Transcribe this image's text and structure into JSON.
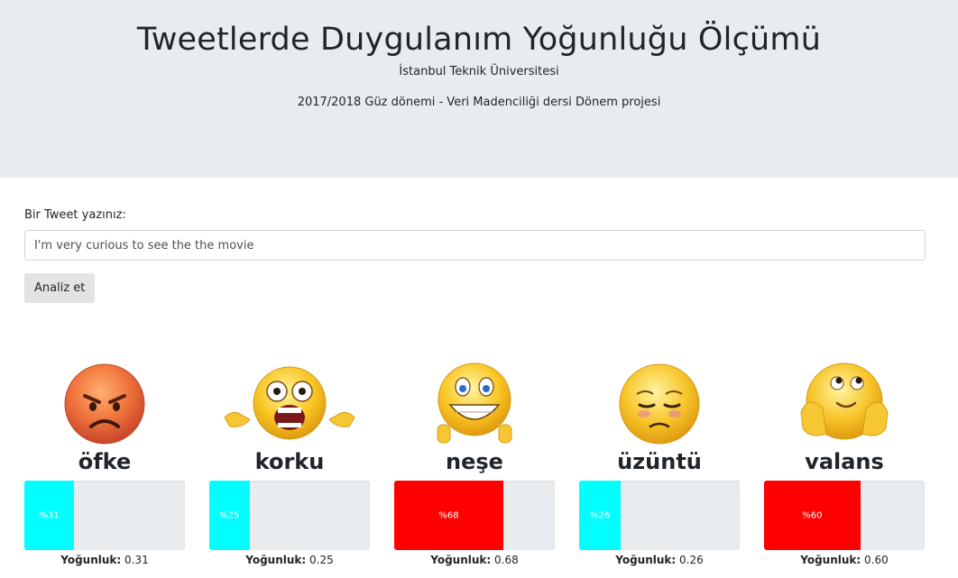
{
  "header": {
    "title": "Tweetlerde Duygulanım Yoğunluğu Ölçümü",
    "university": "İstanbul Teknik Üniversitesi",
    "course": "2017/2018 Güz dönemi - Veri Madenciliği dersi Dönem projesi"
  },
  "form": {
    "label": "Bir Tweet yazınız:",
    "value": "I'm very curious to see the the movie",
    "button_label": "Analiz et"
  },
  "intensity_label": "Yoğunluk:",
  "emotions": [
    {
      "name": "öfke",
      "icon": "angry-face-icon",
      "percent_label": "%31",
      "value": 0.31,
      "value_text": "0.31",
      "bar_color": "#00ffff"
    },
    {
      "name": "korku",
      "icon": "scared-face-icon",
      "percent_label": "%25",
      "value": 0.25,
      "value_text": "0.25",
      "bar_color": "#00ffff"
    },
    {
      "name": "neşe",
      "icon": "grinning-face-icon",
      "percent_label": "%68",
      "value": 0.68,
      "value_text": "0.68",
      "bar_color": "#ff0000"
    },
    {
      "name": "üzüntü",
      "icon": "sad-face-icon",
      "percent_label": "%26",
      "value": 0.26,
      "value_text": "0.26",
      "bar_color": "#00ffff"
    },
    {
      "name": "valans",
      "icon": "dreaming-face-icon",
      "percent_label": "%60",
      "value": 0.6,
      "value_text": "0.60",
      "bar_color": "#ff0000"
    }
  ]
}
